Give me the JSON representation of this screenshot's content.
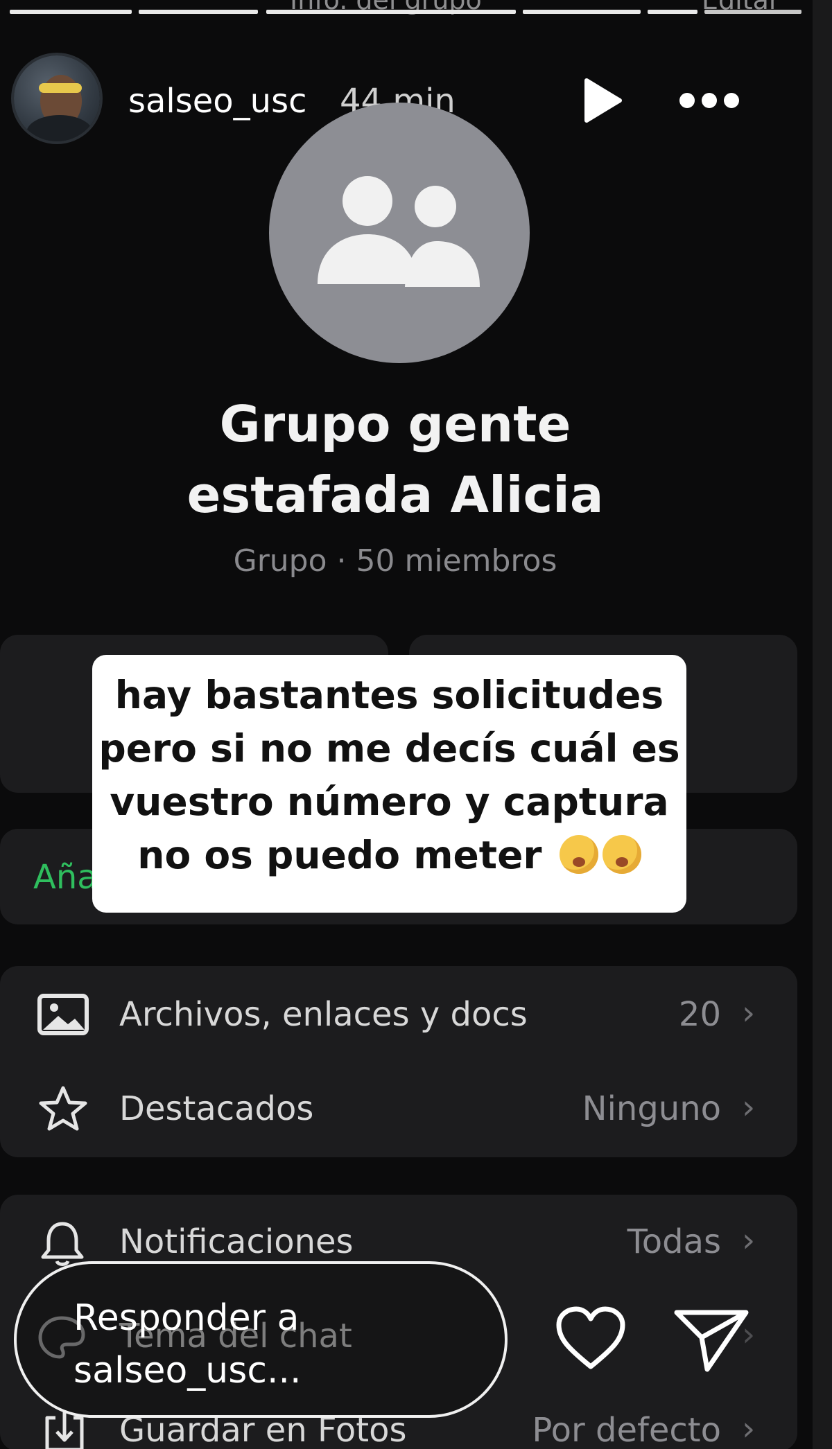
{
  "story": {
    "progress_segments": 6,
    "ghost_top_left": "Info. del grupo",
    "ghost_top_right": "Editar",
    "username": "salseo_usc",
    "time": "44 min",
    "icons": {
      "play": "play-icon",
      "more": "more-dots-icon",
      "heart": "heart-icon",
      "send": "send-icon"
    }
  },
  "group": {
    "title_line1": "Grupo gente",
    "title_line2": "estafada Alicia",
    "subtitle": "Grupo · 50 miembros",
    "add_label_partial": "Aña",
    "rows": [
      {
        "icon": "photo-icon",
        "label": "Archivos, enlaces y docs",
        "value": "20"
      },
      {
        "icon": "star-icon",
        "label": "Destacados",
        "value": "Ninguno"
      },
      {
        "icon": "bell-icon",
        "label": "Notificaciones",
        "value": "Todas"
      },
      {
        "icon": "palette-icon",
        "label": "Tema del chat",
        "value": ""
      },
      {
        "icon": "download-icon",
        "label": "Guardar en Fotos",
        "value": "Por defecto"
      }
    ]
  },
  "sticker": {
    "lines": [
      "hay bastantes solicitudes",
      "pero si no me decís cuál es",
      "vuestro número y captura",
      "no os puedo meter"
    ],
    "emoji": "😥😥"
  },
  "reply": {
    "line1": "Responder a",
    "line2": "salseo_usc..."
  },
  "colors": {
    "accent_green": "#2fbe5e",
    "card": "#1c1c1e",
    "background": "#0b0b0c"
  }
}
